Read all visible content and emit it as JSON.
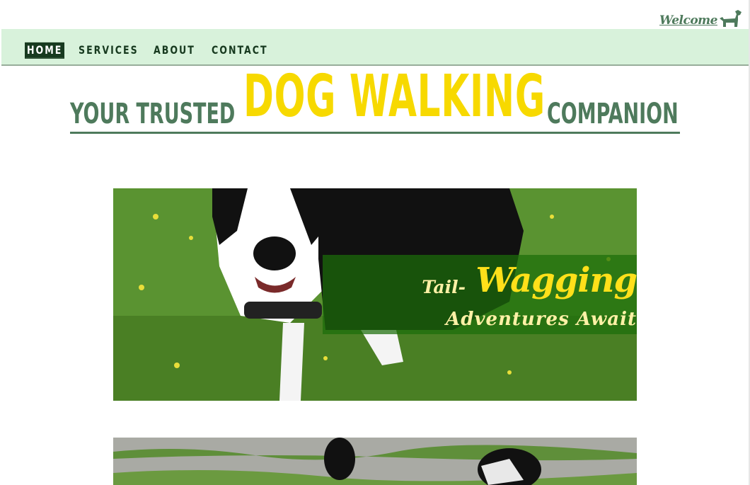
{
  "header": {
    "welcome_label": "Welcome",
    "icon": "dog-icon"
  },
  "nav": {
    "items": [
      {
        "label": "HOME",
        "active": true
      },
      {
        "label": "SERVICES",
        "active": false
      },
      {
        "label": "ABOUT",
        "active": false
      },
      {
        "label": "CONTACT",
        "active": false
      }
    ]
  },
  "headline": {
    "part1": "YOUR TRUSTED",
    "highlight": "DOG WALKING",
    "part3": "COMPANION"
  },
  "hero": {
    "tag_prefix": "Tail-",
    "tag_main": "Wagging",
    "tag_sub": "Adventures Await"
  },
  "colors": {
    "accent_green": "#4e7a5c",
    "nav_bg": "#d8f2db",
    "highlight_yellow": "#f7d900",
    "nav_text": "#173a1f"
  }
}
